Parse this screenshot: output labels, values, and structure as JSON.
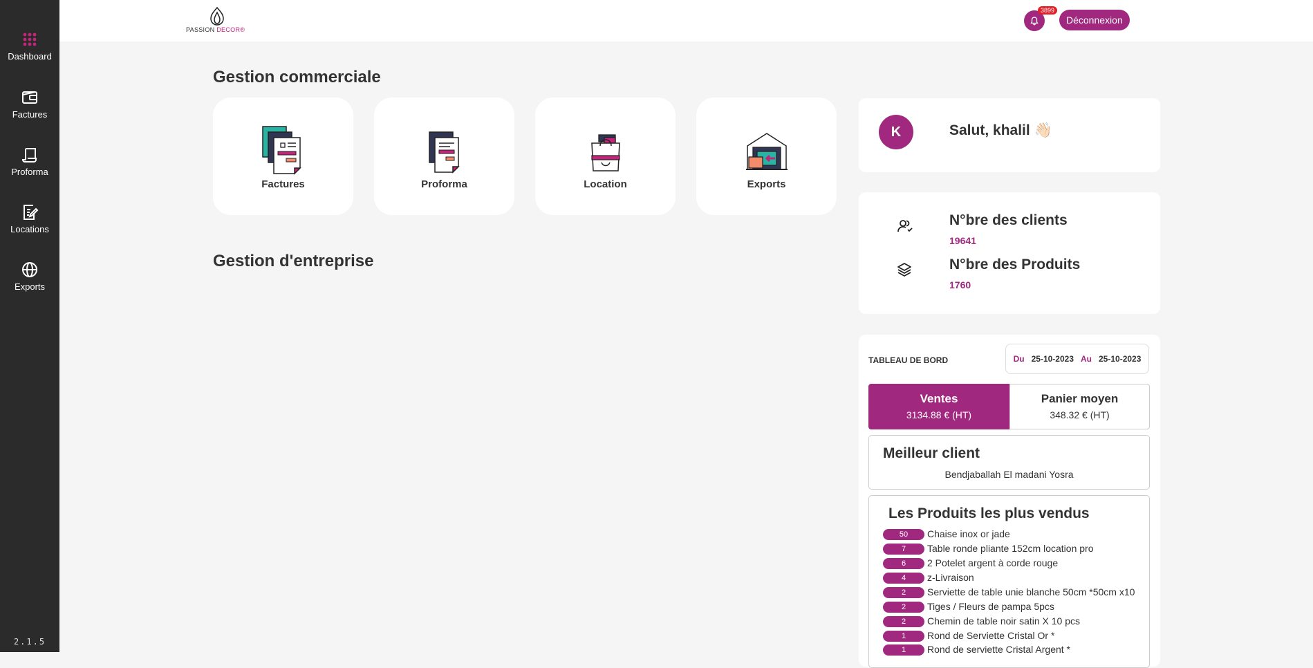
{
  "sidebar": {
    "items": [
      {
        "label": "Dashboard",
        "icon": "grid-icon"
      },
      {
        "label": "Factures",
        "icon": "wallet-icon"
      },
      {
        "label": "Proforma",
        "icon": "scroll-icon"
      },
      {
        "label": "Locations",
        "icon": "edit-document-icon"
      },
      {
        "label": "Exports",
        "icon": "globe-icon"
      }
    ],
    "version": "2.1.5"
  },
  "header": {
    "logo_text_left": "PASSION ",
    "logo_text_right": "DECOR",
    "logo_mark": "®",
    "notification_count": "3899",
    "logout_label": "Déconnexion"
  },
  "main": {
    "section1_title": "Gestion commerciale",
    "section2_title": "Gestion d'entreprise",
    "tiles": [
      {
        "label": "Factures",
        "icon": "invoices-icon"
      },
      {
        "label": "Proforma",
        "icon": "proforma-icon"
      },
      {
        "label": "Location",
        "icon": "shopping-bag-icon"
      },
      {
        "label": "Exports",
        "icon": "warehouse-icon"
      }
    ]
  },
  "profile": {
    "avatar_letter": "K",
    "greeting": "Salut, khalil 👋🏻"
  },
  "stats": {
    "clients_title": "N°bre des clients",
    "clients_value": "19641",
    "products_title": "N°bre des Produits",
    "products_value": "1760"
  },
  "dashboard": {
    "title": "TABLEAU DE BORD",
    "from_label": "Du",
    "from_date": "25-10-2023",
    "to_label": "Au",
    "to_date": "25-10-2023",
    "sales_label": "Ventes",
    "sales_value": "3134.88 € (HT)",
    "basket_label": "Panier moyen",
    "basket_value": "348.32 € (HT)",
    "best_client_title": "Meilleur client",
    "best_client_name": "Bendjaballah El madani Yosra",
    "top_products_title": "Les Produits les plus vendus",
    "top_products": [
      {
        "qty": "50",
        "name": "Chaise inox or jade"
      },
      {
        "qty": "7",
        "name": "Table ronde pliante 152cm location pro"
      },
      {
        "qty": "6",
        "name": "2 Potelet argent à corde rouge"
      },
      {
        "qty": "4",
        "name": "z-Livraison"
      },
      {
        "qty": "2",
        "name": "Serviette de table unie blanche 50cm *50cm x10"
      },
      {
        "qty": "2",
        "name": "Tiges / Fleurs de pampa 5pcs"
      },
      {
        "qty": "2",
        "name": "Chemin de table noir satin X 10 pcs"
      },
      {
        "qty": "1",
        "name": "Rond de Serviette Cristal Or *"
      },
      {
        "qty": "1",
        "name": "Rond de serviette Cristal Argent *"
      }
    ]
  },
  "colors": {
    "accent": "#a0297f",
    "sidebar": "#2b2b2b",
    "badge": "#e3202a"
  }
}
